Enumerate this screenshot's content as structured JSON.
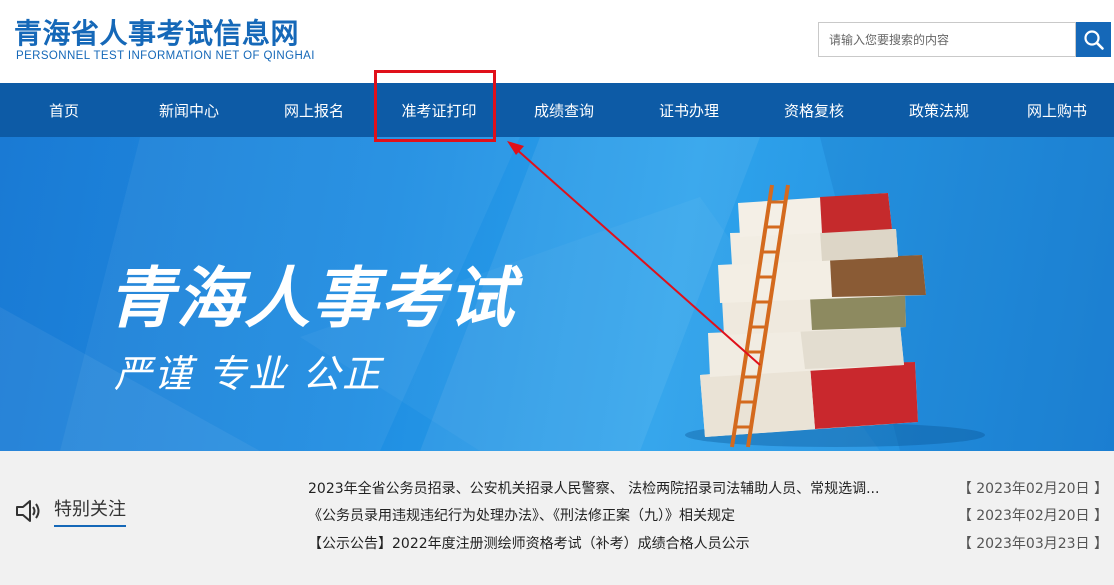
{
  "header": {
    "logo_cn": "青海省人事考试信息网",
    "logo_en": "PERSONNEL TEST INFORMATION NET OF QINGHAI",
    "search_placeholder": "请输入您要搜索的内容"
  },
  "nav": {
    "items": [
      {
        "label": "首页"
      },
      {
        "label": "新闻中心"
      },
      {
        "label": "网上报名"
      },
      {
        "label": "准考证打印"
      },
      {
        "label": "成绩查询"
      },
      {
        "label": "证书办理"
      },
      {
        "label": "资格复核"
      },
      {
        "label": "政策法规"
      },
      {
        "label": "网上购书"
      }
    ]
  },
  "banner": {
    "title": "青海人事考试",
    "subtitle": "严谨 专业 公正"
  },
  "notice": {
    "label": "特别关注",
    "items": [
      {
        "title": "2023年全省公务员招录、公安机关招录人民警察、 法检两院招录司法辅助人员、常规选调...",
        "date": "【 2023年02月20日 】"
      },
      {
        "title": "《公务员录用违规违纪行为处理办法》、《刑法修正案（九）》相关规定",
        "date": "【 2023年02月20日 】"
      },
      {
        "title": "【公示公告】2022年度注册测绘师资格考试（补考）成绩合格人员公示",
        "date": "【 2023年03月23日 】"
      }
    ]
  },
  "colors": {
    "brand": "#1568b8",
    "nav_bg": "#0d5ba6",
    "highlight": "#e0101a"
  }
}
